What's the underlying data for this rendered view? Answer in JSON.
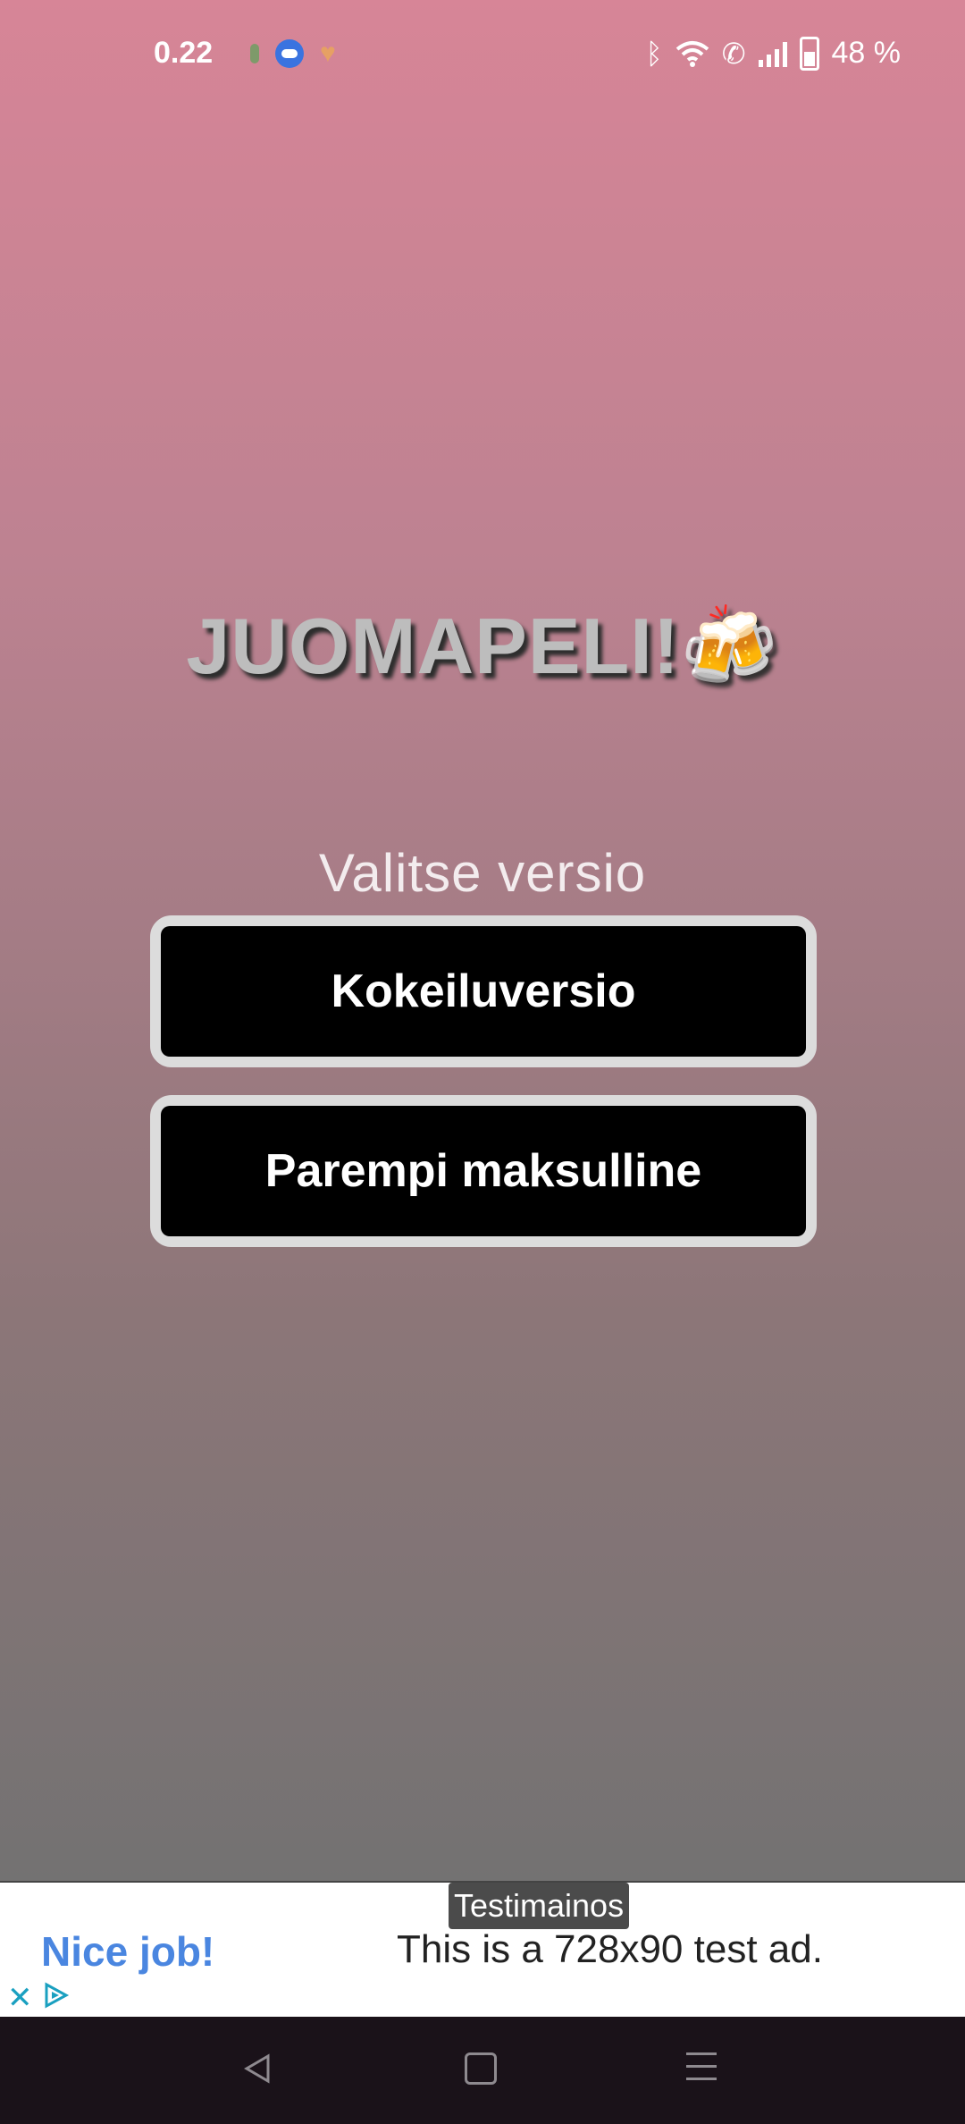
{
  "status_bar": {
    "time": "0.22",
    "battery": "48 %",
    "icons": [
      "notification-dot-icon",
      "weather-icon",
      "heart-icon",
      "bluetooth-icon",
      "wifi-icon",
      "wifi-calling-icon",
      "signal-icon",
      "battery-icon"
    ]
  },
  "app": {
    "title": "JUOMAPELI!🍻",
    "subtitle": "Valitse versio",
    "buttons": {
      "trial": "Kokeiluversio",
      "paid": "Parempi maksulline"
    }
  },
  "ad": {
    "label": "Testimainos",
    "headline": "Nice job!",
    "text": "This is a 728x90 test ad.",
    "colors": {
      "headline": "#4a86e0",
      "choices": "#1aa0c0"
    }
  },
  "nav_bar": {
    "icons": [
      "back-icon",
      "home-icon",
      "recents-icon"
    ]
  }
}
